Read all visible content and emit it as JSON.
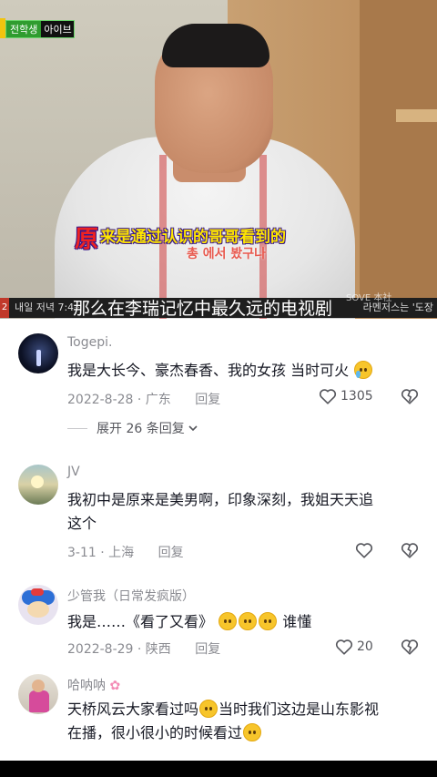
{
  "video": {
    "show_logo_green": "전학생",
    "show_logo_rest": "아이브",
    "overlay_cn_first": "原",
    "overlay_cn": "来是通过认识的哥哥看到的",
    "overlay_kr": "총 에서 봤구나",
    "ticker_num": "2",
    "ticker_left": "내일 저녁 7:40",
    "ticker_right": "라멘저스는 '도장",
    "caption": "那么在李瑞记忆中最久远的电视剧",
    "watermark": "SOVE 本社"
  },
  "comments": [
    {
      "user": "Togepi.",
      "text": "我是大长今、豪杰春香、我的女孩 当时可火",
      "emoji_count": 1,
      "date": "2022-8-28 · 广东",
      "reply_label": "回复",
      "likes": "1305",
      "expand_label": "展开 26 条回复"
    },
    {
      "user": "JV",
      "text_line1": "我初中是原来是美男啊，印象深刻，我姐天天追",
      "text_line2": "这个",
      "date": "3-11 · 上海",
      "reply_label": "回复"
    },
    {
      "user": "少管我（日常发疯版）",
      "text_prefix": "我是……《看了又看》",
      "text_suffix": "谁懂",
      "date": "2022-8-29 · 陕西",
      "reply_label": "回复",
      "likes": "20"
    },
    {
      "user": "哈呐呐",
      "text_line1_a": "天桥风云大家看过吗",
      "text_line1_b": "当时我们这边是山东影视",
      "text_line2": "在播，很小很小的时候看过"
    }
  ],
  "icons": {
    "like": "heart-outline-icon",
    "dislike": "broken-heart-icon",
    "expand": "chevron-down-icon"
  }
}
